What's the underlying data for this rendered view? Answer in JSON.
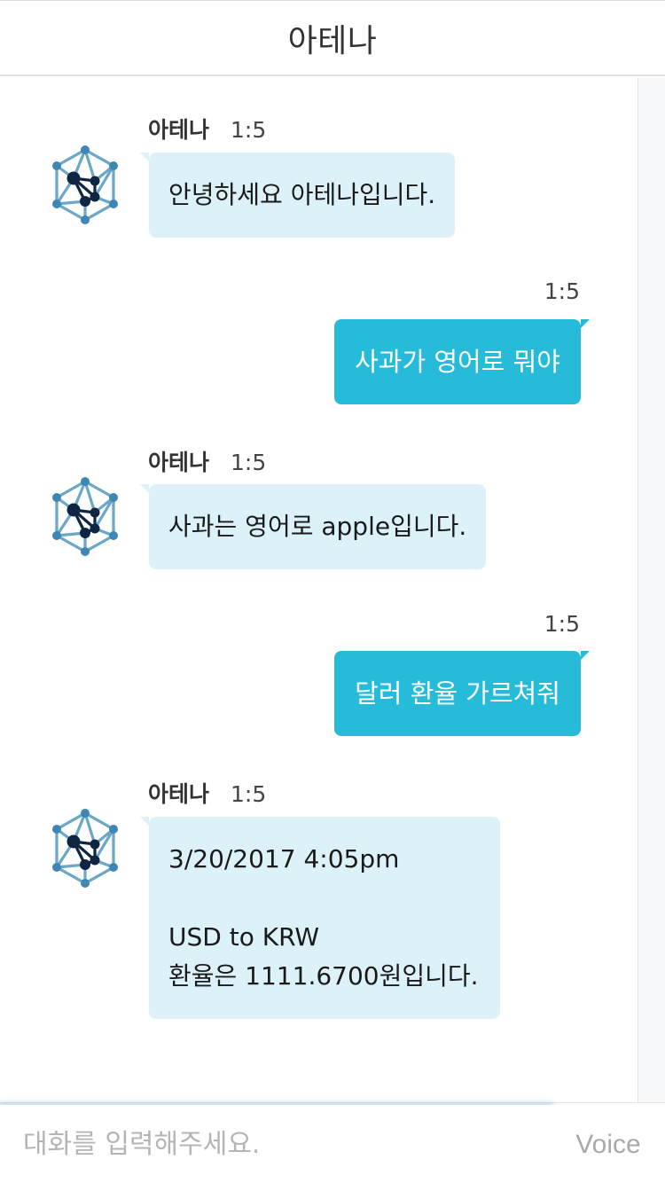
{
  "header": {
    "title": "아테나"
  },
  "bot": {
    "name": "아테나",
    "avatar_icon": "network-hexagon-icon"
  },
  "messages": [
    {
      "sender": "bot",
      "time": "1:5",
      "text": "안녕하세요 아테나입니다."
    },
    {
      "sender": "user",
      "time": "1:5",
      "text": "사과가 영어로 뭐야"
    },
    {
      "sender": "bot",
      "time": "1:5",
      "text": "사과는 영어로 apple입니다."
    },
    {
      "sender": "user",
      "time": "1:5",
      "text": "달러 환율 가르쳐줘"
    },
    {
      "sender": "bot",
      "time": "1:5",
      "lines": [
        "3/20/2017 4:05pm",
        "",
        "USD to KRW",
        "환율은 1111.6700원입니다."
      ]
    }
  ],
  "input": {
    "placeholder": "대화를 입력해주세요.",
    "value": ""
  },
  "voice_button": {
    "label": "Voice"
  },
  "colors": {
    "bot_bubble": "#ddf2f8",
    "user_bubble": "#26bcd9",
    "avatar_light": "#6aa7c9",
    "avatar_dark": "#0e2642"
  }
}
